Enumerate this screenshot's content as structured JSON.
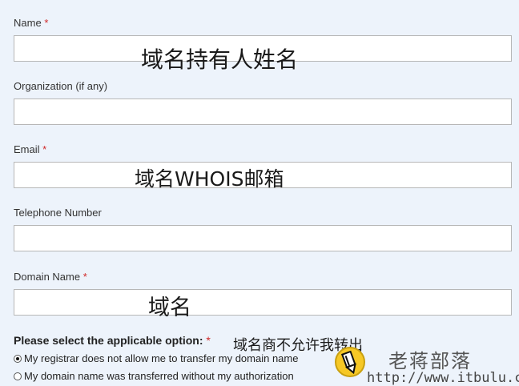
{
  "form": {
    "name": {
      "label": "Name",
      "required": "*",
      "value": ""
    },
    "organization": {
      "label": "Organization (if any)",
      "value": ""
    },
    "email": {
      "label": "Email",
      "required": "*",
      "value": ""
    },
    "telephone": {
      "label": "Telephone Number",
      "value": ""
    },
    "domain": {
      "label": "Domain Name",
      "required": "*",
      "value": ""
    },
    "option": {
      "title": "Please select the applicable option:",
      "required": "*",
      "choices": [
        {
          "label": "My registrar does not allow me to transfer my domain name",
          "selected": true
        },
        {
          "label": "My domain name was transferred without my authorization",
          "selected": false
        }
      ]
    }
  },
  "annotations": {
    "name": "域名持有人姓名",
    "email": "域名WHOIS邮箱",
    "domain": "域名",
    "option": "域名商不允许我转出"
  },
  "watermark": {
    "title": "老蒋部落",
    "url": "http://www.itbulu.com",
    "logo_icon": "pencil-logo-icon"
  },
  "colors": {
    "background": "#edf3fb",
    "required": "#d02828",
    "logo": "#f6c826"
  }
}
